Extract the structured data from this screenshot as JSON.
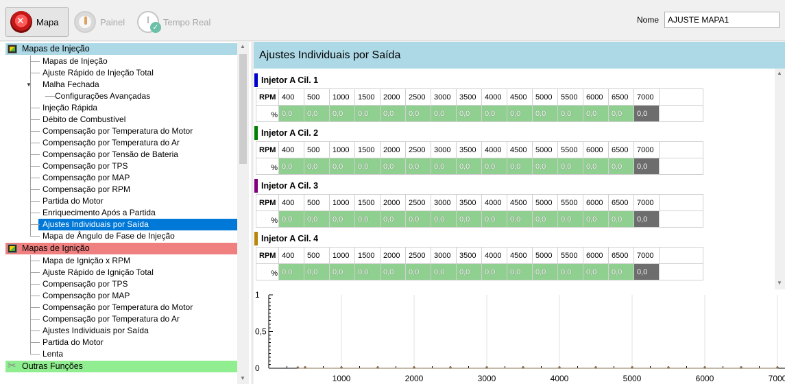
{
  "toolbar": {
    "tabs": [
      {
        "label": "Mapa",
        "icon": "close-circle-icon"
      },
      {
        "label": "Painel",
        "icon": "gauge-icon"
      },
      {
        "label": "Tempo Real",
        "icon": "clock-check-icon"
      }
    ],
    "nome_label": "Nome",
    "nome_value": "AJUSTE MAPA1"
  },
  "tree": {
    "sections": [
      {
        "label": "Mapas de Injeção",
        "items": [
          "Mapas de Injeção",
          "Ajuste Rápido de Injeção Total",
          "Malha Fechada",
          "Configurações Avançadas",
          "Injeção Rápida",
          "Débito de Combustível",
          "Compensação por Temperatura do Motor",
          "Compensação por Temperatura do Ar",
          "Compensação por Tensão de Bateria",
          "Compensação por TPS",
          "Compensação por MAP",
          "Compensação por RPM",
          "Partida do Motor",
          "Enriquecimento Após a Partida",
          "Ajustes Individuais por Saída",
          "Mapa de Ângulo de Fase de Injeção"
        ]
      },
      {
        "label": "Mapas de Ignição",
        "items": [
          "Mapa de Ignição x RPM",
          "Ajuste Rápido de Ignição Total",
          "Compensação por TPS",
          "Compensação por MAP",
          "Compensação por Temperatura do Motor",
          "Compensação por Temperatura do Ar",
          "Ajustes Individuais por Saída",
          "Partida do Motor",
          "Lenta"
        ]
      },
      {
        "label": "Outras Funções",
        "items": []
      }
    ],
    "selected": "Ajustes Individuais por Saída"
  },
  "panel": {
    "title": "Ajustes Individuais por Saída",
    "rpm_label": "RPM",
    "pct_label": "%",
    "rpm_values": [
      "400",
      "500",
      "1000",
      "1500",
      "2000",
      "2500",
      "3000",
      "3500",
      "4000",
      "4500",
      "5000",
      "5500",
      "6000",
      "6500",
      "7000"
    ],
    "injectors": [
      {
        "label": "Injetor A Cil. 1",
        "color": "#0000cd",
        "values": [
          "0,0",
          "0,0",
          "0,0",
          "0,0",
          "0,0",
          "0,0",
          "0,0",
          "0,0",
          "0,0",
          "0,0",
          "0,0",
          "0,0",
          "0,0",
          "0,0",
          "0,0"
        ]
      },
      {
        "label": "Injetor A Cil. 2",
        "color": "#008000",
        "values": [
          "0,0",
          "0,0",
          "0,0",
          "0,0",
          "0,0",
          "0,0",
          "0,0",
          "0,0",
          "0,0",
          "0,0",
          "0,0",
          "0,0",
          "0,0",
          "0,0",
          "0,0"
        ]
      },
      {
        "label": "Injetor A Cil. 3",
        "color": "#800080",
        "values": [
          "0,0",
          "0,0",
          "0,0",
          "0,0",
          "0,0",
          "0,0",
          "0,0",
          "0,0",
          "0,0",
          "0,0",
          "0,0",
          "0,0",
          "0,0",
          "0,0",
          "0,0"
        ]
      },
      {
        "label": "Injetor A Cil. 4",
        "color": "#b8860b",
        "values": [
          "0,0",
          "0,0",
          "0,0",
          "0,0",
          "0,0",
          "0,0",
          "0,0",
          "0,0",
          "0,0",
          "0,0",
          "0,0",
          "0,0",
          "0,0",
          "0,0",
          "0,0"
        ]
      }
    ]
  },
  "chart_data": {
    "type": "line",
    "x_ticks": [
      "1000",
      "2000",
      "3000",
      "4000",
      "5000",
      "6000",
      "7000"
    ],
    "y_ticks": [
      "0",
      "0,5",
      "1"
    ],
    "xlim": [
      0,
      7000
    ],
    "ylim": [
      0,
      1
    ],
    "x": [
      400,
      500,
      1000,
      1500,
      2000,
      2500,
      3000,
      3500,
      4000,
      4500,
      5000,
      5500,
      6000,
      6500,
      7000
    ],
    "series": [
      {
        "values": [
          0,
          0,
          0,
          0,
          0,
          0,
          0,
          0,
          0,
          0,
          0,
          0,
          0,
          0,
          0
        ],
        "color": "#8b7355"
      }
    ],
    "grid": true
  }
}
